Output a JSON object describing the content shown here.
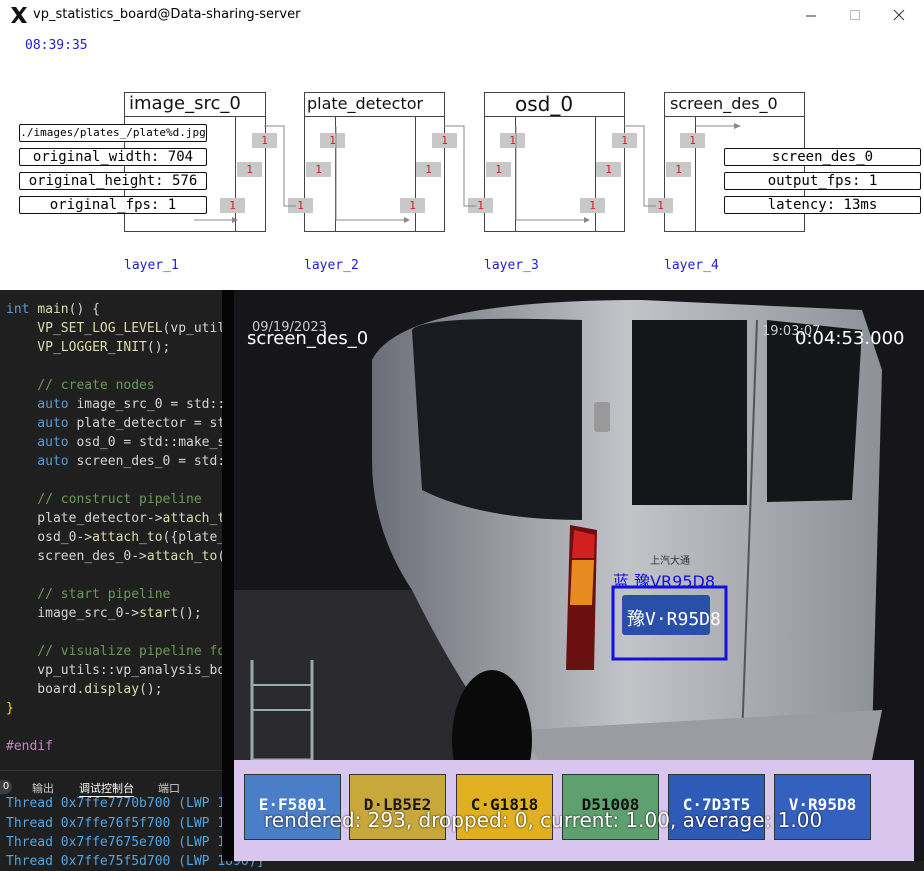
{
  "window": {
    "title": "vp_statistics_board@Data-sharing-server",
    "clock": "08:39:35"
  },
  "nodes": [
    {
      "name": "image_src_0",
      "layer": "layer_1",
      "configs": [
        "./images/plates_/plate%d.jpg",
        "original_width: 704",
        "original_height: 576",
        "original_fps: 1"
      ],
      "ports": [
        "1",
        "1",
        "1"
      ]
    },
    {
      "name": "plate_detector",
      "layer": "layer_2",
      "ports": [
        "1",
        "1",
        "1",
        "1",
        "1",
        "1"
      ]
    },
    {
      "name": "osd_0",
      "layer": "layer_3",
      "ports": [
        "1",
        "1",
        "1",
        "1",
        "1",
        "1"
      ]
    },
    {
      "name": "screen_des_0",
      "layer": "layer_4",
      "configs": [
        "screen_des_0",
        "output_fps: 1",
        "latency: 13ms"
      ],
      "ports": [
        "1",
        "1",
        "1"
      ]
    }
  ],
  "editor": {
    "lines": [
      {
        "parts": [
          {
            "t": "int ",
            "c": "#569cd6"
          },
          {
            "t": "main",
            "c": "#dcdcaa"
          },
          {
            "t": "() {",
            "c": "#d4d4d4"
          }
        ]
      },
      {
        "parts": [
          {
            "t": "    VP_SET_LOG_LEVEL",
            "c": "#dcdcaa"
          },
          {
            "t": "(vp_util",
            "c": "#d4d4d4"
          }
        ]
      },
      {
        "parts": [
          {
            "t": "    VP_LOGGER_INIT",
            "c": "#dcdcaa"
          },
          {
            "t": "();",
            "c": "#d4d4d4"
          }
        ]
      },
      {
        "parts": []
      },
      {
        "parts": [
          {
            "t": "    // create nodes",
            "c": "#6a9955"
          }
        ]
      },
      {
        "parts": [
          {
            "t": "    auto ",
            "c": "#569cd6"
          },
          {
            "t": "image_src_0 = std::",
            "c": "#d4d4d4"
          }
        ]
      },
      {
        "parts": [
          {
            "t": "    auto ",
            "c": "#569cd6"
          },
          {
            "t": "plate_detector = st",
            "c": "#d4d4d4"
          }
        ]
      },
      {
        "parts": [
          {
            "t": "    auto ",
            "c": "#569cd6"
          },
          {
            "t": "osd_0 = std::make_s",
            "c": "#d4d4d4"
          }
        ]
      },
      {
        "parts": [
          {
            "t": "    auto ",
            "c": "#569cd6"
          },
          {
            "t": "screen_des_0 = std:",
            "c": "#d4d4d4"
          }
        ]
      },
      {
        "parts": []
      },
      {
        "parts": [
          {
            "t": "    // construct pipeline",
            "c": "#6a9955"
          }
        ]
      },
      {
        "parts": [
          {
            "t": "    plate_detector->",
            "c": "#d4d4d4"
          },
          {
            "t": "attach_t",
            "c": "#dcdcaa"
          }
        ]
      },
      {
        "parts": [
          {
            "t": "    osd_0->",
            "c": "#d4d4d4"
          },
          {
            "t": "attach_to",
            "c": "#dcdcaa"
          },
          {
            "t": "({plate_",
            "c": "#d4d4d4"
          }
        ]
      },
      {
        "parts": [
          {
            "t": "    screen_des_0->",
            "c": "#d4d4d4"
          },
          {
            "t": "attach_to",
            "c": "#dcdcaa"
          },
          {
            "t": "(",
            "c": "#d4d4d4"
          }
        ]
      },
      {
        "parts": []
      },
      {
        "parts": [
          {
            "t": "    // start pipeline",
            "c": "#6a9955"
          }
        ]
      },
      {
        "parts": [
          {
            "t": "    image_src_0->",
            "c": "#d4d4d4"
          },
          {
            "t": "start",
            "c": "#dcdcaa"
          },
          {
            "t": "();",
            "c": "#d4d4d4"
          }
        ]
      },
      {
        "parts": []
      },
      {
        "parts": [
          {
            "t": "    // visualize pipeline fo",
            "c": "#6a9955"
          }
        ]
      },
      {
        "parts": [
          {
            "t": "    vp_utils::vp_analysis_bo",
            "c": "#d4d4d4"
          }
        ]
      },
      {
        "parts": [
          {
            "t": "    board.",
            "c": "#d4d4d4"
          },
          {
            "t": "display",
            "c": "#dcdcaa"
          },
          {
            "t": "();",
            "c": "#d4d4d4"
          }
        ]
      },
      {
        "parts": [
          {
            "t": "}",
            "c": "#ffd700"
          }
        ]
      },
      {
        "parts": []
      },
      {
        "parts": [
          {
            "t": "#endif",
            "c": "#c586c0"
          }
        ]
      }
    ]
  },
  "panel": {
    "badge": "0",
    "tabs": [
      "输出",
      "调试控制台",
      "端口"
    ],
    "active_tab": "调试控制台"
  },
  "terminal": {
    "lines": [
      "Thread 0x7ffe7770b700 (LWP 1",
      "Thread 0x7ffe76f5f700 (LWP 1",
      "Thread 0x7ffe7675e700 (LWP 1",
      "Thread 0x7ffe75f5d700 (LWP 1896)]"
    ]
  },
  "video": {
    "channel": "screen_des_0",
    "timestamp": "0:04:53.000",
    "camera_date": "09/19/2023",
    "camera_time": "19:03:07",
    "vehicle_badge": "上汽大通",
    "detection_label": "蓝 豫VR95D8",
    "plate_text": "豫V·R95D8",
    "stats": "rendered: 293, dropped: 0, current: 1.00, average: 1.00",
    "thumbnails": [
      {
        "text": "E·F5801",
        "bg": "#4a7ec8",
        "fg": "#ffffff"
      },
      {
        "text": "D·LB5E2",
        "bg": "#c8a83a",
        "fg": "#1a1a1a"
      },
      {
        "text": "C·G1818",
        "bg": "#e0b020",
        "fg": "#111111"
      },
      {
        "text": "D51008",
        "bg": "#5fa070",
        "fg": "#111111"
      },
      {
        "text": "C·7D3T5",
        "bg": "#2e5ab8",
        "fg": "#ffffff"
      },
      {
        "text": "V·R95D8",
        "bg": "#3460c0",
        "fg": "#ffffff"
      }
    ]
  },
  "colors": {
    "layer_text": "#2020d0",
    "port_bg": "#c8c8c8",
    "port_text": "#d02020",
    "detection_box": "#1010e0",
    "thumb_strip": "#d8c6ee"
  }
}
